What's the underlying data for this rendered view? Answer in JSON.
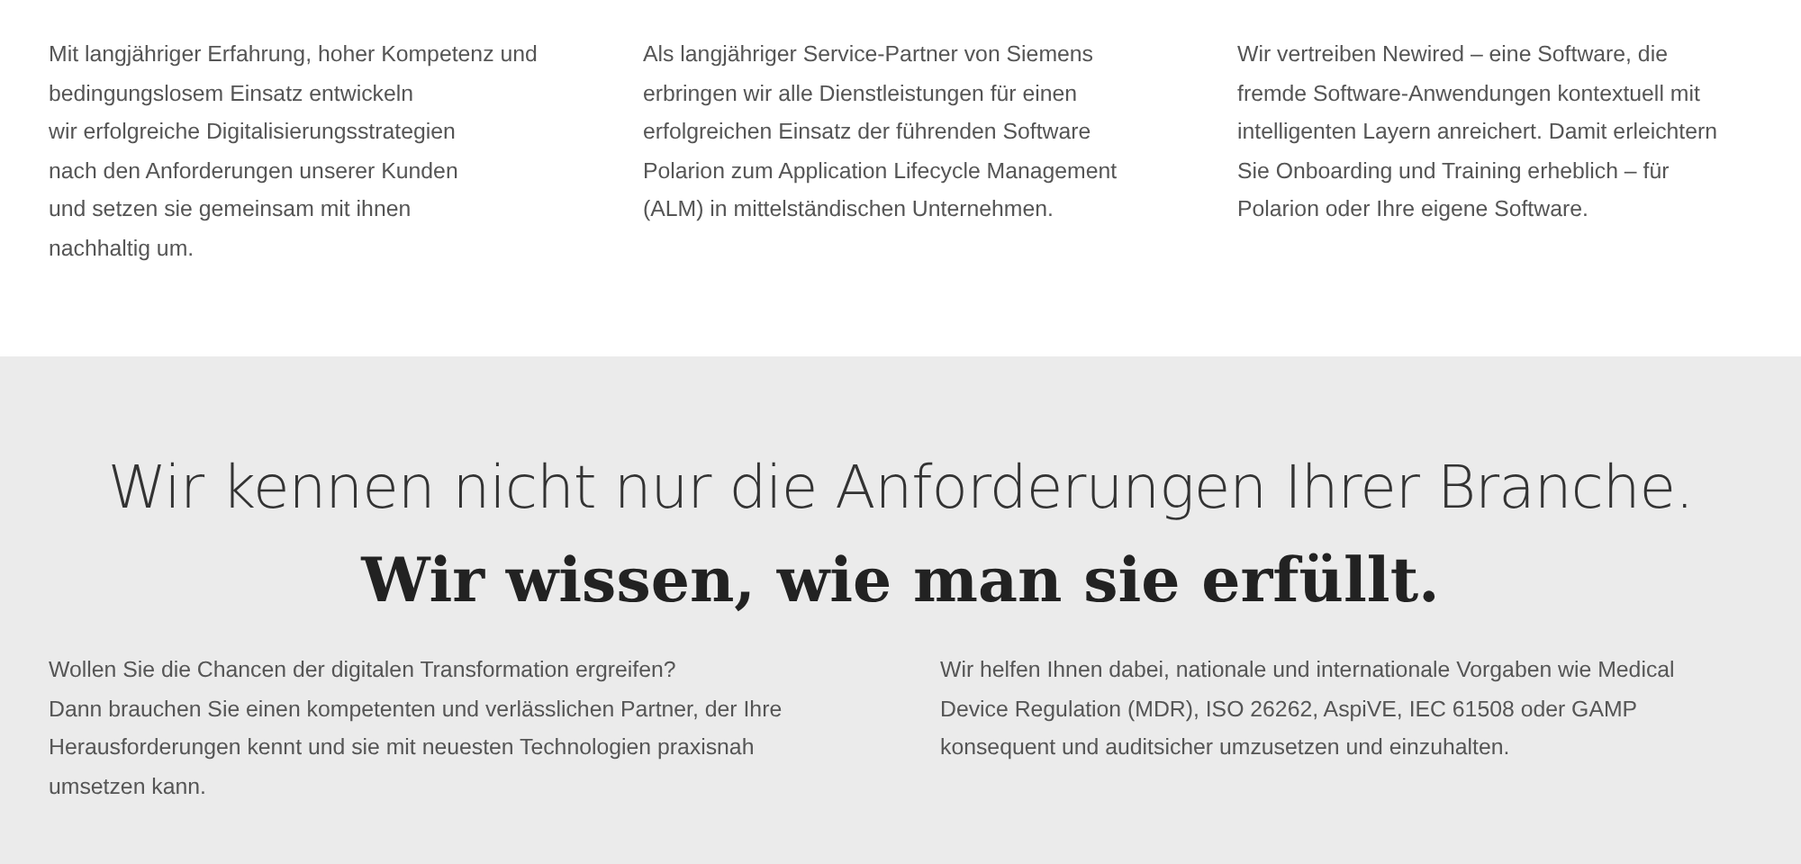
{
  "services": [
    {
      "text": "Mit langjähriger Erfahrung, hoher Kompetenz und\nbedingungslosem Einsatz entwickeln\nwir erfolgreiche Digitalisierungsstrategien\nnach den Anforderungen unserer Kunden\nund setzen sie gemeinsam mit ihnen\nnachhaltig um."
    },
    {
      "text": "Als langjähriger Service-Partner von Siemens\nerbringen wir alle Dienstleistungen für einen\nerfolgreichen Einsatz der führenden Software\nPolarion zum Application Lifecycle Management\n(ALM) in mittelständischen Unternehmen."
    },
    {
      "text": "Wir vertreiben Newired – eine Software, die\nfremde Software-Anwendungen kontextuell mit\nintelligenten Layern anreichert. Damit erleichtern\nSie Onboarding und Training erheblich – für\nPolarion oder Ihre eigene Software."
    }
  ],
  "claim": {
    "headline": "Wir kennen nicht nur die Anforderungen Ihrer Branche.",
    "subheadline": "Wir wissen, wie man sie erfüllt.",
    "paragraphs": [
      "Wollen Sie die Chancen der digitalen Transformation ergreifen?\nDann brauchen Sie einen kompetenten und verlässlichen Partner, der Ihre\nHerausforderungen kennt und sie mit neuesten Technologien praxisnah\numsetzen kann.",
      "Wir helfen Ihnen dabei, nationale und internationale Vorgaben wie Medical\nDevice Regulation (MDR), ISO 26262, AspiVE, IEC 61508 oder GAMP\nkonsequent und auditsicher umzusetzen und einzuhalten."
    ]
  }
}
